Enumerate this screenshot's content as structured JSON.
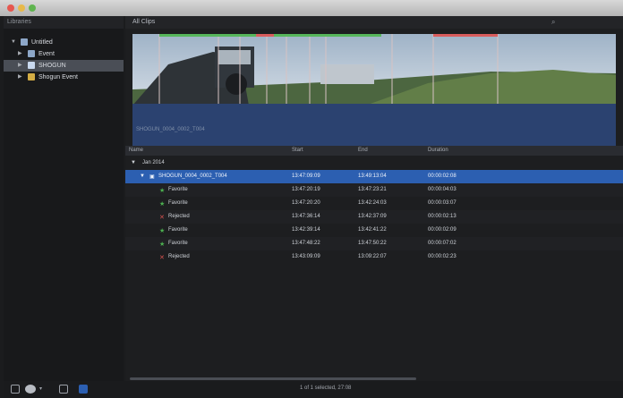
{
  "window": {
    "traffic_lights": [
      "#e6574f",
      "#e7b94b",
      "#5fb44f"
    ]
  },
  "sidebar": {
    "header": "Libraries",
    "items": [
      {
        "label": "Untitled",
        "level": 0,
        "selected": false
      },
      {
        "label": "Event",
        "level": 1,
        "selected": false
      },
      {
        "label": "SHOGUN",
        "level": 1,
        "selected": true
      },
      {
        "label": "Shogun Event",
        "level": 1,
        "selected": false
      }
    ]
  },
  "browser": {
    "title": "All Clips",
    "clip_caption": "SHOGUN_0004_0002_T004"
  },
  "list": {
    "columns": [
      "Name",
      "Start",
      "End",
      "Duration"
    ],
    "group_label": "Jan 2014",
    "rows": [
      {
        "name": "SHOGUN_0004_0002_T004",
        "start": "13:47:09:09",
        "end": "13:49:13:04",
        "duration": "00:00:02:08",
        "kind": "clip",
        "selected": true
      },
      {
        "name": "Favorite",
        "start": "13:47:20:19",
        "end": "13:47:23:21",
        "duration": "00:00:04:03",
        "kind": "favorite"
      },
      {
        "name": "Favorite",
        "start": "13:47:20:20",
        "end": "13:42:24:03",
        "duration": "00:00:03:07",
        "kind": "favorite"
      },
      {
        "name": "Rejected",
        "start": "13:47:36:14",
        "end": "13:42:37:09",
        "duration": "00:00:02:13",
        "kind": "rejected"
      },
      {
        "name": "Favorite",
        "start": "13:42:39:14",
        "end": "13:42:41:22",
        "duration": "00:00:02:09",
        "kind": "favorite"
      },
      {
        "name": "Favorite",
        "start": "13:47:48:22",
        "end": "13:47:50:22",
        "duration": "00:00:07:02",
        "kind": "favorite"
      },
      {
        "name": "Rejected",
        "start": "13:43:09:09",
        "end": "13:09:22:07",
        "duration": "00:00:02:23",
        "kind": "rejected"
      }
    ]
  },
  "status": {
    "text": "1 of 1 selected, 27:08"
  },
  "colors": {
    "selection": "#2c5fb1",
    "favorite": "#4caf50",
    "rejected": "#d9534f"
  }
}
